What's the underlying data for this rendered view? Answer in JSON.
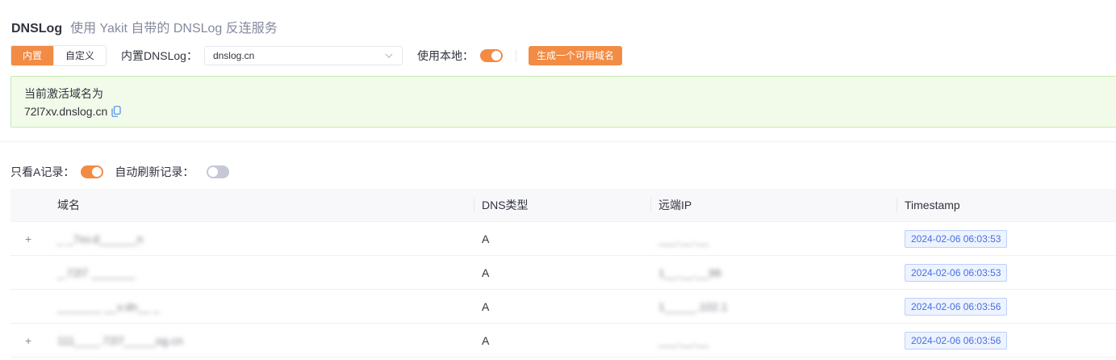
{
  "header": {
    "title": "DNSLog",
    "subtitle": "使用 Yakit 自带的 DNSLog 反连服务"
  },
  "toolbar": {
    "mode_builtin": "内置",
    "mode_custom": "自定义",
    "builtin_dnslog_label": "内置DNSLog：",
    "dnslog_selected": "dnslog.cn",
    "use_local_label": "使用本地：",
    "use_local_on": true,
    "generate_button": "生成一个可用域名"
  },
  "active": {
    "label": "当前激活域名为",
    "domain": "72l7xv.dnslog.cn"
  },
  "filters": {
    "only_a_label": "只看A记录：",
    "only_a_on": true,
    "auto_refresh_label": "自动刷新记录：",
    "auto_refresh_on": false
  },
  "table": {
    "columns": [
      "域名",
      "DNS类型",
      "远端IP",
      "Timestamp"
    ],
    "rows": [
      {
        "expand": "+",
        "domain": "_ _7xv.d______n",
        "type": "A",
        "ip": "___.__.__",
        "timestamp": "2024-02-06 06:03:53"
      },
      {
        "expand": "",
        "domain": "_.72l7 _______",
        "type": "A",
        "ip": "1__.__.__96",
        "timestamp": "2024-02-06 06:03:53"
      },
      {
        "expand": "",
        "domain": "_______ __v.dn__ _",
        "type": "A",
        "ip": "1_____.102.1",
        "timestamp": "2024-02-06 06:03:56"
      },
      {
        "expand": "+",
        "domain": "111____.72l7_____og.cn",
        "type": "A",
        "ip": "___.__.__",
        "timestamp": "2024-02-06 06:03:56"
      }
    ]
  },
  "colors": {
    "accent": "#f28b44",
    "success_bg": "#f2fbe9",
    "tag_blue": "#4a6ee0"
  }
}
